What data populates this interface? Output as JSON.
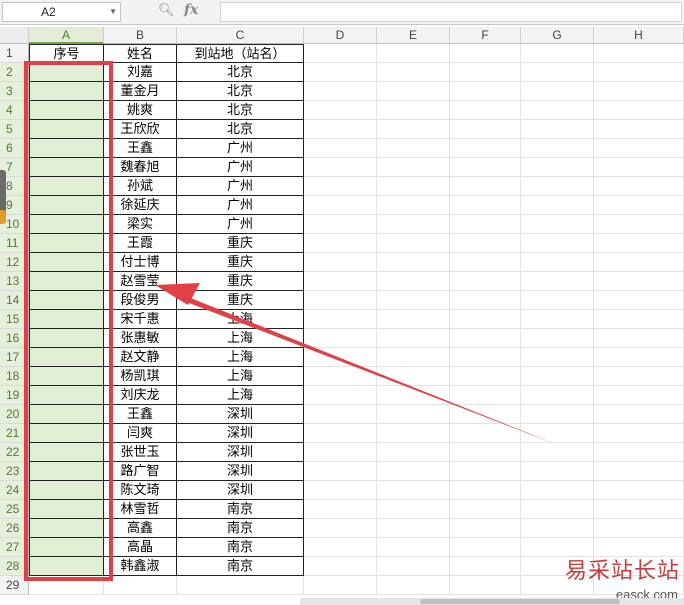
{
  "formula_bar": {
    "name_box": "A2",
    "zoom_icon": "zoom-icon",
    "fx_label": "fx",
    "formula_value": ""
  },
  "columns": [
    "A",
    "B",
    "C",
    "D",
    "E",
    "F",
    "G",
    "H"
  ],
  "selected_column": "A",
  "header_row": {
    "row": "1",
    "a": "序号",
    "b": "姓名",
    "c": "到站地（站名）"
  },
  "rows": [
    {
      "n": "2",
      "name": "刘嘉",
      "station": "北京"
    },
    {
      "n": "3",
      "name": "董金月",
      "station": "北京"
    },
    {
      "n": "4",
      "name": "姚爽",
      "station": "北京"
    },
    {
      "n": "5",
      "name": "王欣欣",
      "station": "北京"
    },
    {
      "n": "6",
      "name": "王鑫",
      "station": "广州"
    },
    {
      "n": "7",
      "name": "魏春旭",
      "station": "广州"
    },
    {
      "n": "8",
      "name": "孙斌",
      "station": "广州"
    },
    {
      "n": "9",
      "name": "徐延庆",
      "station": "广州"
    },
    {
      "n": "10",
      "name": "梁实",
      "station": "广州"
    },
    {
      "n": "11",
      "name": "王霞",
      "station": "重庆"
    },
    {
      "n": "12",
      "name": "付士博",
      "station": "重庆"
    },
    {
      "n": "13",
      "name": "赵雪莹",
      "station": "重庆"
    },
    {
      "n": "14",
      "name": "段俊男",
      "station": "重庆"
    },
    {
      "n": "15",
      "name": "宋千惠",
      "station": "上海"
    },
    {
      "n": "16",
      "name": "张惠敏",
      "station": "上海"
    },
    {
      "n": "17",
      "name": "赵文静",
      "station": "上海"
    },
    {
      "n": "18",
      "name": "杨凯琪",
      "station": "上海"
    },
    {
      "n": "19",
      "name": "刘庆龙",
      "station": "上海"
    },
    {
      "n": "20",
      "name": "王鑫",
      "station": "深圳"
    },
    {
      "n": "21",
      "name": "闫爽",
      "station": "深圳"
    },
    {
      "n": "22",
      "name": "张世玉",
      "station": "深圳"
    },
    {
      "n": "23",
      "name": "路广智",
      "station": "深圳"
    },
    {
      "n": "24",
      "name": "陈文琦",
      "station": "深圳"
    },
    {
      "n": "25",
      "name": "林雪哲",
      "station": "南京"
    },
    {
      "n": "26",
      "name": "高鑫",
      "station": "南京"
    },
    {
      "n": "27",
      "name": "高晶",
      "station": "南京"
    },
    {
      "n": "28",
      "name": "韩鑫淑",
      "station": "南京"
    }
  ],
  "last_row": "29",
  "annotation": {
    "box_color": "#e24047",
    "arrow_color": "#e24047"
  },
  "watermark": {
    "logo_text": "易采站长站",
    "url_text": "easck.com"
  }
}
